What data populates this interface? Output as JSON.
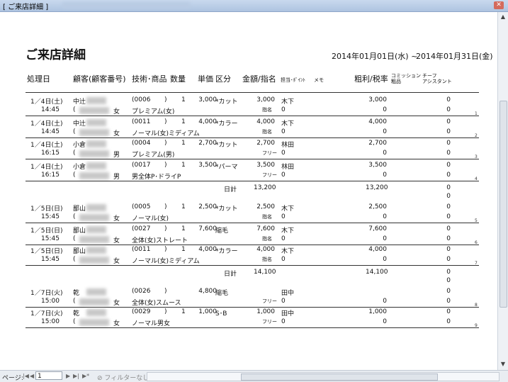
{
  "window": {
    "title": "[  ご来店詳細  ]",
    "close_label": "✕"
  },
  "report": {
    "title": "ご来店詳細",
    "period_from": "2014年01月01日(水)  ~",
    "period_to": "2014年01月31日(金)",
    "headers": {
      "date": "処理日",
      "customer": "顧客(顧客番号)",
      "item": "技術･商品",
      "qty": "数量",
      "price": "単価",
      "category": "区分",
      "amount": "金額/指名",
      "staff": "担当･ﾎﾟｲﾝﾄ",
      "memo": "メモ",
      "profit": "粗利/税率",
      "commission_1": "コミッション",
      "commission_2": "粗品",
      "chief_1": "チーフ",
      "chief_2": "アシスタント"
    },
    "rows": [
      {
        "date": "1／4日(土)",
        "time": "14:45",
        "name": "中辻",
        "paren_open": "(",
        "gender": "女",
        "code": "(0006",
        "code_close": ")",
        "qty": "1",
        "item": "プレミアム(女)",
        "price": "3,000",
        "category": "*カット",
        "amount": "3,000",
        "nomination": "指名",
        "staff": "木下",
        "points": "0",
        "profit": "3,000",
        "tax": "0",
        "commission": "0",
        "chief": "0",
        "index": "1"
      },
      {
        "date": "1／4日(土)",
        "time": "14:45",
        "name": "中辻",
        "paren_open": "(",
        "gender": "女",
        "code": "(0011",
        "code_close": ")",
        "qty": "1",
        "item": "ノーマル(女)ミディアム",
        "price": "4,000",
        "category": "*カラー",
        "amount": "4,000",
        "nomination": "指名",
        "staff": "木下",
        "points": "0",
        "profit": "4,000",
        "tax": "0",
        "commission": "0",
        "chief": "0",
        "index": "2"
      },
      {
        "date": "1／4日(土)",
        "time": "16:15",
        "name": "小倉",
        "paren_open": "(",
        "gender": "男",
        "code": "(0004",
        "code_close": ")",
        "qty": "1",
        "item": "プレミアム(男)",
        "price": "2,700",
        "category": "*カット",
        "amount": "2,700",
        "nomination": "フリー",
        "staff": "林田",
        "points": "0",
        "profit": "2,700",
        "tax": "0",
        "commission": "0",
        "chief": "0",
        "index": "3"
      },
      {
        "date": "1／4日(土)",
        "time": "16:15",
        "name": "小倉",
        "paren_open": "(",
        "gender": "男",
        "code": "(0017",
        "code_close": ")",
        "qty": "1",
        "item": "男全体P･ドライP",
        "price": "3,500",
        "category": "*パーマ",
        "amount": "3,500",
        "nomination": "フリー",
        "staff": "林田",
        "points": "0",
        "profit": "3,500",
        "tax": "0",
        "commission": "0",
        "chief": "0",
        "index": "4"
      },
      {
        "date": "1／5日(日)",
        "time": "15:45",
        "name": "鄙山",
        "paren_open": "(",
        "gender": "女",
        "code": "(0005",
        "code_close": ")",
        "qty": "1",
        "item": "ノーマル(女)",
        "price": "2,500",
        "category": "*カット",
        "amount": "2,500",
        "nomination": "指名",
        "staff": "木下",
        "points": "0",
        "profit": "2,500",
        "tax": "0",
        "commission": "0",
        "chief": "0",
        "index": "5"
      },
      {
        "date": "1／5日(日)",
        "time": "15:45",
        "name": "鄙山",
        "paren_open": "(",
        "gender": "女",
        "code": "(0027",
        "code_close": ")",
        "qty": "1",
        "item": "全体(女)ストレート",
        "price": "7,600",
        "category": "縮毛",
        "amount": "7,600",
        "nomination": "指名",
        "staff": "木下",
        "points": "0",
        "profit": "7,600",
        "tax": "0",
        "commission": "0",
        "chief": "0",
        "index": "6"
      },
      {
        "date": "1／5日(日)",
        "time": "15:45",
        "name": "鄙山",
        "paren_open": "(",
        "gender": "女",
        "code": "(0011",
        "code_close": ")",
        "qty": "1",
        "item": "ノーマル(女)ミディアム",
        "price": "4,000",
        "category": "*カラー",
        "amount": "4,000",
        "nomination": "指名",
        "staff": "木下",
        "points": "0",
        "profit": "4,000",
        "tax": "0",
        "commission": "0",
        "chief": "0",
        "index": "7"
      },
      {
        "date": "1／7日(火)",
        "time": "15:00",
        "name": "乾",
        "paren_open": "(",
        "gender": "女",
        "code": "(0026",
        "code_close": ")",
        "qty": "",
        "item": "全体(女)スムース",
        "price": "4,800",
        "category": "縮毛",
        "amount": "",
        "nomination": "フリー",
        "staff": "田中",
        "points": "0",
        "profit": "",
        "tax": "0",
        "commission": "0",
        "chief": "0",
        "index": "8"
      },
      {
        "date": "1／7日(火)",
        "time": "15:00",
        "name": "乾",
        "paren_open": "(",
        "gender": "女",
        "code": "(0029",
        "code_close": ")",
        "qty": "1",
        "item": "ノーマル男女",
        "price": "1,000",
        "category": "S･B",
        "amount": "1,000",
        "nomination": "フリー",
        "staff": "田中",
        "points": "0",
        "profit": "1,000",
        "tax": "0",
        "commission": "0",
        "chief": "0",
        "index": "9"
      }
    ],
    "subtotals": [
      {
        "label": "日計",
        "amount": "13,200",
        "profit": "13,200",
        "commission": "0",
        "chief": "0"
      },
      {
        "label": "日計",
        "amount": "14,100",
        "profit": "14,100",
        "commission": "0",
        "chief": "0"
      }
    ]
  },
  "statusbar": {
    "page_label": "ページ:",
    "page_value": "1",
    "first_icon": "first-page-icon",
    "prev_icon": "prev-page-icon",
    "next_icon": "next-page-icon",
    "last_icon": "last-page-icon",
    "filter_label": "フィルターなし"
  }
}
